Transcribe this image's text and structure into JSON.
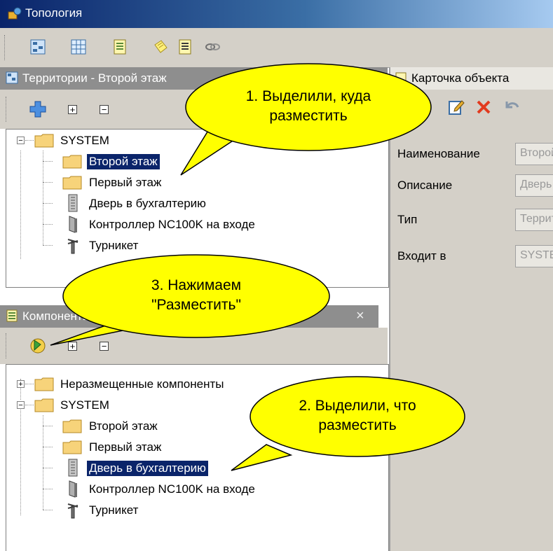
{
  "window": {
    "title": "Топология"
  },
  "colors": {
    "selection": "#0a246a",
    "callout_fill": "#ffff00",
    "panel_title": "#8e8e8e",
    "delete_icon": "#e23a1e"
  },
  "toolbar": {
    "icons": [
      "topology-icon",
      "grid-icon",
      "document-icon",
      "notes-icon",
      "list-icon",
      "link-icon"
    ]
  },
  "territories_panel": {
    "title": "Территории - Второй этаж",
    "tools": [
      "add-icon",
      "expand-all-icon",
      "collapse-all-icon"
    ],
    "tree": {
      "root": {
        "label": "SYSTEM",
        "expander": "−"
      },
      "items": [
        {
          "label": "Второй этаж",
          "icon": "folder-icon",
          "selected": true
        },
        {
          "label": "Первый этаж",
          "icon": "folder-icon",
          "selected": false
        },
        {
          "label": "Дверь в бухгалтерию",
          "icon": "door-icon",
          "selected": false
        },
        {
          "label": "Контроллер NC100K на входе",
          "icon": "controller-icon",
          "selected": false
        },
        {
          "label": "Турникет",
          "icon": "turnstile-icon",
          "selected": false
        }
      ]
    }
  },
  "components_panel": {
    "title": "Компоненты",
    "close": "×",
    "tools": [
      "place-icon",
      "expand-all-icon",
      "collapse-all-icon"
    ],
    "tree": {
      "unplaced": {
        "label": "Неразмещенные компоненты",
        "expander": "+"
      },
      "root": {
        "label": "SYSTEM",
        "expander": "−"
      },
      "items": [
        {
          "label": "Второй этаж",
          "icon": "folder-icon",
          "selected": false
        },
        {
          "label": "Первый этаж",
          "icon": "folder-icon",
          "selected": false
        },
        {
          "label": "Дверь в бухгалтерию",
          "icon": "door-icon",
          "selected": true
        },
        {
          "label": "Контроллер NC100K на входе",
          "icon": "controller-icon",
          "selected": false
        },
        {
          "label": "Турникет",
          "icon": "turnstile-icon",
          "selected": false
        }
      ]
    }
  },
  "object_card": {
    "title": "Карточка объекта",
    "tools": [
      "edit-icon",
      "delete-icon",
      "undo-icon"
    ],
    "fields": [
      {
        "label": "Наименование",
        "value": "Второй этаж"
      },
      {
        "label": "Описание",
        "value": "Дверь"
      },
      {
        "label": "Тип",
        "value": "Территория"
      },
      {
        "label": "Входит в",
        "value": "SYSTEM"
      }
    ]
  },
  "callouts": [
    {
      "line1": "1. Выделили, куда",
      "line2": "разместить"
    },
    {
      "line1": "2. Выделили, что",
      "line2": "разместить"
    },
    {
      "line1": "3. Нажимаем",
      "line2": "\"Разместить\""
    }
  ]
}
